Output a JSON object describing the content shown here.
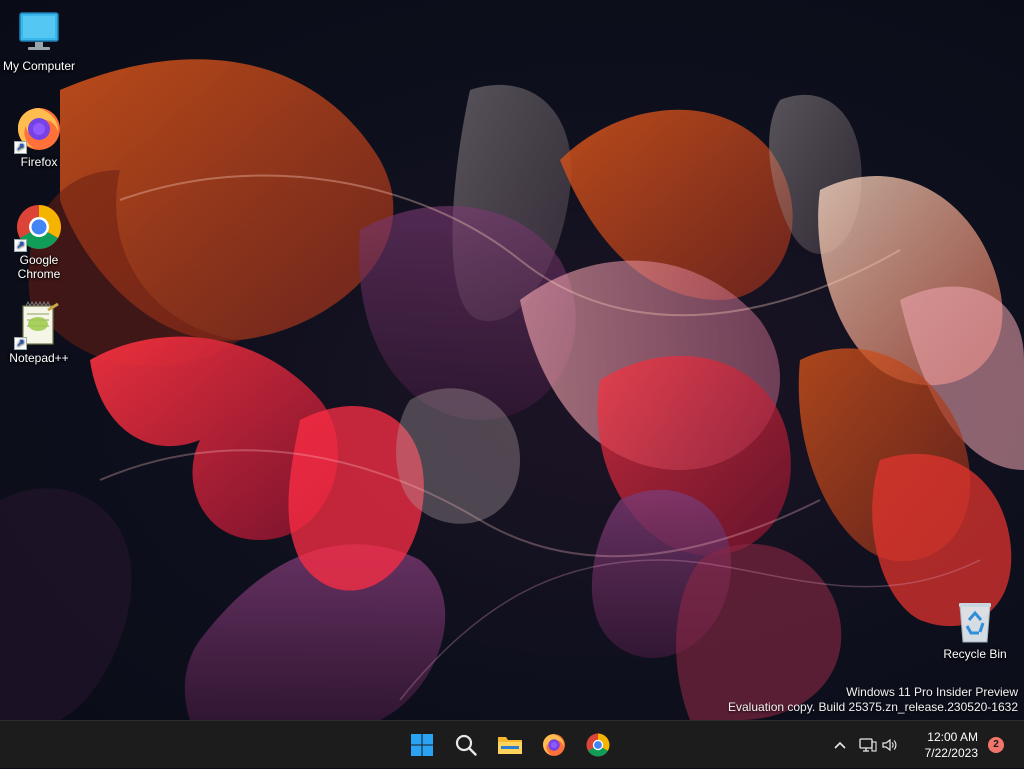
{
  "desktop_icons": [
    {
      "id": "my-computer",
      "label": "My Computer",
      "icon": "monitor-icon"
    },
    {
      "id": "firefox",
      "label": "Firefox",
      "icon": "firefox-icon",
      "shortcut": true
    },
    {
      "id": "chrome",
      "label": "Google Chrome",
      "label_lines": [
        "Google",
        "Chrome"
      ],
      "icon": "chrome-icon",
      "shortcut": true
    },
    {
      "id": "notepadpp",
      "label": "Notepad++",
      "icon": "notepad-plus-plus-icon",
      "shortcut": true
    },
    {
      "id": "recycle-bin",
      "label": "Recycle Bin",
      "icon": "recycle-bin-icon"
    }
  ],
  "watermark": {
    "line1": "Windows 11 Pro Insider Preview",
    "line2": "Evaluation copy. Build 25375.zn_release.230520-1632"
  },
  "taskbar": {
    "apps": [
      {
        "id": "start",
        "icon": "windows-start-icon"
      },
      {
        "id": "search",
        "icon": "search-icon"
      },
      {
        "id": "file-explorer",
        "icon": "folder-icon"
      },
      {
        "id": "firefox",
        "icon": "firefox-icon"
      },
      {
        "id": "chrome",
        "icon": "chrome-icon"
      }
    ],
    "tray": {
      "overflow_icon": "chevron-up-icon",
      "network_icon": "network-icon",
      "volume_icon": "volume-icon",
      "time": "12:00 AM",
      "date": "7/22/2023",
      "notification_count": "2"
    }
  },
  "colors": {
    "taskbar_bg": "#1c1c1c",
    "windows_blue": "#2aa3f5",
    "notification_badge": "#f2756b"
  }
}
